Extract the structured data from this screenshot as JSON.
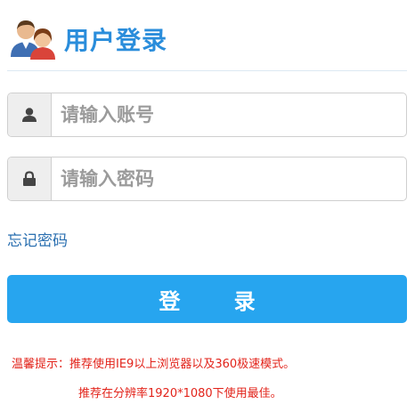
{
  "header": {
    "title": "用户登录",
    "icon": "users-icon"
  },
  "form": {
    "username": {
      "placeholder": "请输入账号",
      "value": "",
      "icon": "user-icon"
    },
    "password": {
      "placeholder": "请输入密码",
      "value": "",
      "icon": "lock-icon"
    },
    "forgot_label": "忘记密码",
    "login_label": "登 录"
  },
  "tips": {
    "line1": "温馨提示：推荐使用IE9以上浏览器以及360极速模式。",
    "line2": "推荐在分辨率1920*1080下使用最佳。"
  },
  "colors": {
    "title": "#2a8ddb",
    "button": "#27a5ef",
    "link": "#2a6fb0",
    "tip": "#e2231a"
  }
}
